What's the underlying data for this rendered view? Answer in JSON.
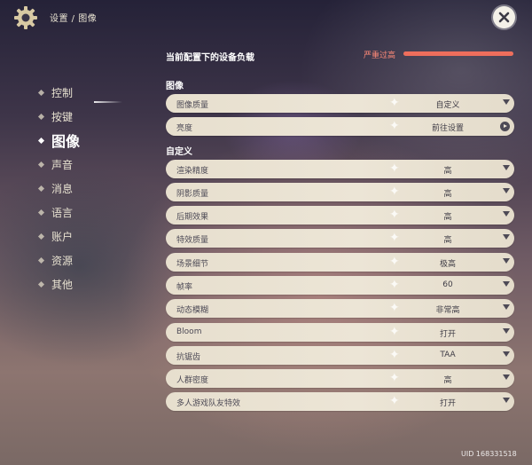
{
  "breadcrumb": "设置 / 图像",
  "sidebar": {
    "items": [
      {
        "label": "控制"
      },
      {
        "label": "按键"
      },
      {
        "label": "图像"
      },
      {
        "label": "声音"
      },
      {
        "label": "消息"
      },
      {
        "label": "语言"
      },
      {
        "label": "账户"
      },
      {
        "label": "资源"
      },
      {
        "label": "其他"
      }
    ],
    "active": "图像"
  },
  "device_load": {
    "title": "当前配置下的设备负载",
    "status": "严重过高",
    "level_fraction": 1.0,
    "color": "#ee6e5c"
  },
  "image_section": {
    "title": "图像",
    "rows": [
      {
        "label": "图像质量",
        "value": "自定义",
        "control": "dropdown"
      },
      {
        "label": "亮度",
        "value": "前往设置",
        "control": "link"
      }
    ]
  },
  "custom_section": {
    "title": "自定义",
    "rows": [
      {
        "label": "渲染精度",
        "value": "高"
      },
      {
        "label": "阴影质量",
        "value": "高"
      },
      {
        "label": "后期效果",
        "value": "高"
      },
      {
        "label": "特效质量",
        "value": "高"
      },
      {
        "label": "场景细节",
        "value": "极高"
      },
      {
        "label": "帧率",
        "value": "60"
      },
      {
        "label": "动态模糊",
        "value": "非常高"
      },
      {
        "label": "Bloom",
        "value": "打开"
      },
      {
        "label": "抗锯齿",
        "value": "TAA"
      },
      {
        "label": "人群密度",
        "value": "高"
      },
      {
        "label": "多人游戏队友特效",
        "value": "打开"
      }
    ]
  },
  "uid_text": "UID 168331518",
  "icons": {
    "settings": "gear-icon",
    "close": "close-icon"
  }
}
